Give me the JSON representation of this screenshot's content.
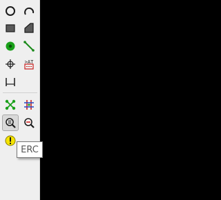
{
  "toolbar": {
    "tools": [
      {
        "id": "circle",
        "icon": "circle-icon"
      },
      {
        "id": "arc",
        "icon": "arc-icon"
      },
      {
        "id": "rectangle",
        "icon": "rectangle-icon"
      },
      {
        "id": "polygon",
        "icon": "polygon-icon"
      },
      {
        "id": "pin",
        "icon": "pin-icon"
      },
      {
        "id": "line",
        "icon": "line-icon"
      },
      {
        "id": "anchor",
        "icon": "anchor-icon"
      },
      {
        "id": "text-field",
        "icon": "text-field-icon"
      },
      {
        "id": "dimension",
        "icon": "dimension-icon"
      },
      {
        "id": "ratsnest",
        "icon": "ratsnest-icon"
      },
      {
        "id": "grid",
        "icon": "grid-icon"
      },
      {
        "id": "inspect",
        "icon": "zoom-inspect-icon",
        "active": true
      },
      {
        "id": "inspect-alt",
        "icon": "zoom-inspect-red-icon"
      },
      {
        "id": "erc",
        "icon": "warning-icon"
      }
    ]
  },
  "tooltip": {
    "text": "ERC"
  },
  "colors": {
    "toolbar_bg": "#efefef",
    "canvas_bg": "#000000",
    "pin_green": "#1aa01a",
    "grid_red": "#c8201e",
    "grid_blue": "#2f50c8",
    "warning_yellow": "#f5e400"
  }
}
